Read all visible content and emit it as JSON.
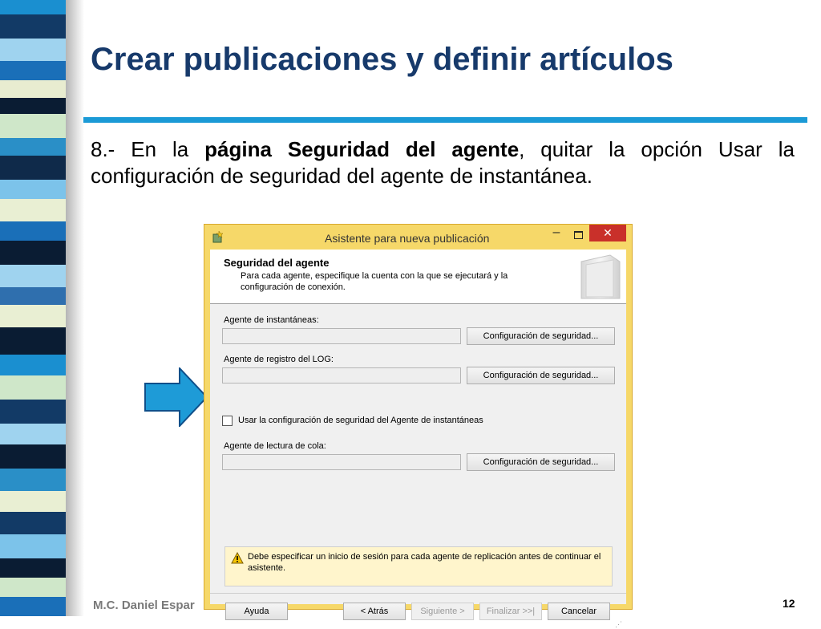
{
  "slide": {
    "title": "Crear publicaciones y definir artículos",
    "body_prefix": "8.- En la ",
    "body_bold": "página Seguridad del agente",
    "body_suffix": ", quitar la opción Usar la configuración de seguridad del agente de instantánea.",
    "footer_author": "M.C. Daniel Espar",
    "page_number": "12",
    "colors": {
      "title": "#173a6b",
      "rule": "#1b9ad6",
      "arrow": "#1e9bd7"
    },
    "icons": [
      "right-arrow-icon"
    ]
  },
  "dialog": {
    "title": "Asistente para nueva publicación",
    "minimize_label": "–",
    "close_label": "✕",
    "header": {
      "title": "Seguridad del agente",
      "description": "Para cada agente, especifique la cuenta con la que se ejecutará y la configuración de conexión."
    },
    "snapshot_agent_label": "Agente de instantáneas:",
    "snapshot_agent_value": "",
    "snapshot_security_button": "Configuración de seguridad...",
    "log_reader_label": "Agente de registro del LOG:",
    "log_reader_value": "",
    "log_reader_security_button": "Configuración de seguridad...",
    "use_snapshot_security_checkbox": "Usar la configuración de seguridad del Agente de instantáneas",
    "use_snapshot_security_checked": false,
    "queue_reader_label": "Agente de lectura de cola:",
    "queue_reader_value": "",
    "queue_reader_security_button": "Configuración de seguridad...",
    "warning_text": "Debe especificar un inicio de sesión para cada agente de replicación antes de continuar el asistente.",
    "buttons": {
      "help": "Ayuda",
      "back": "< Atrás",
      "next": "Siguiente >",
      "finish": "Finalizar >>|",
      "cancel": "Cancelar"
    },
    "icons": [
      "wizard-app-icon",
      "book-graphic-icon",
      "warning-icon",
      "checkbox-icon"
    ]
  }
}
